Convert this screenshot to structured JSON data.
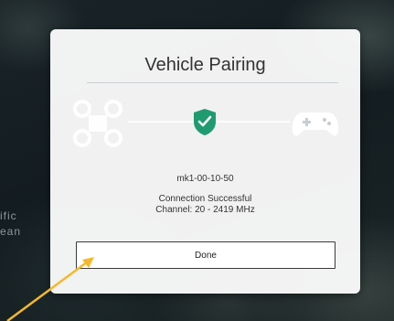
{
  "background": {
    "map_label_line1": "ific",
    "map_label_line2": "ean"
  },
  "dialog": {
    "title": "Vehicle Pairing",
    "device_name": "mk1-00-10-50",
    "status": "Connection Successful",
    "channel": "Channel: 20 - 2419 MHz",
    "done_label": "Done",
    "icons": [
      "drone-icon",
      "shield-check-icon",
      "gamepad-icon"
    ]
  },
  "colors": {
    "accent": "#1f9b6f",
    "annotation": "#f5b82a"
  }
}
